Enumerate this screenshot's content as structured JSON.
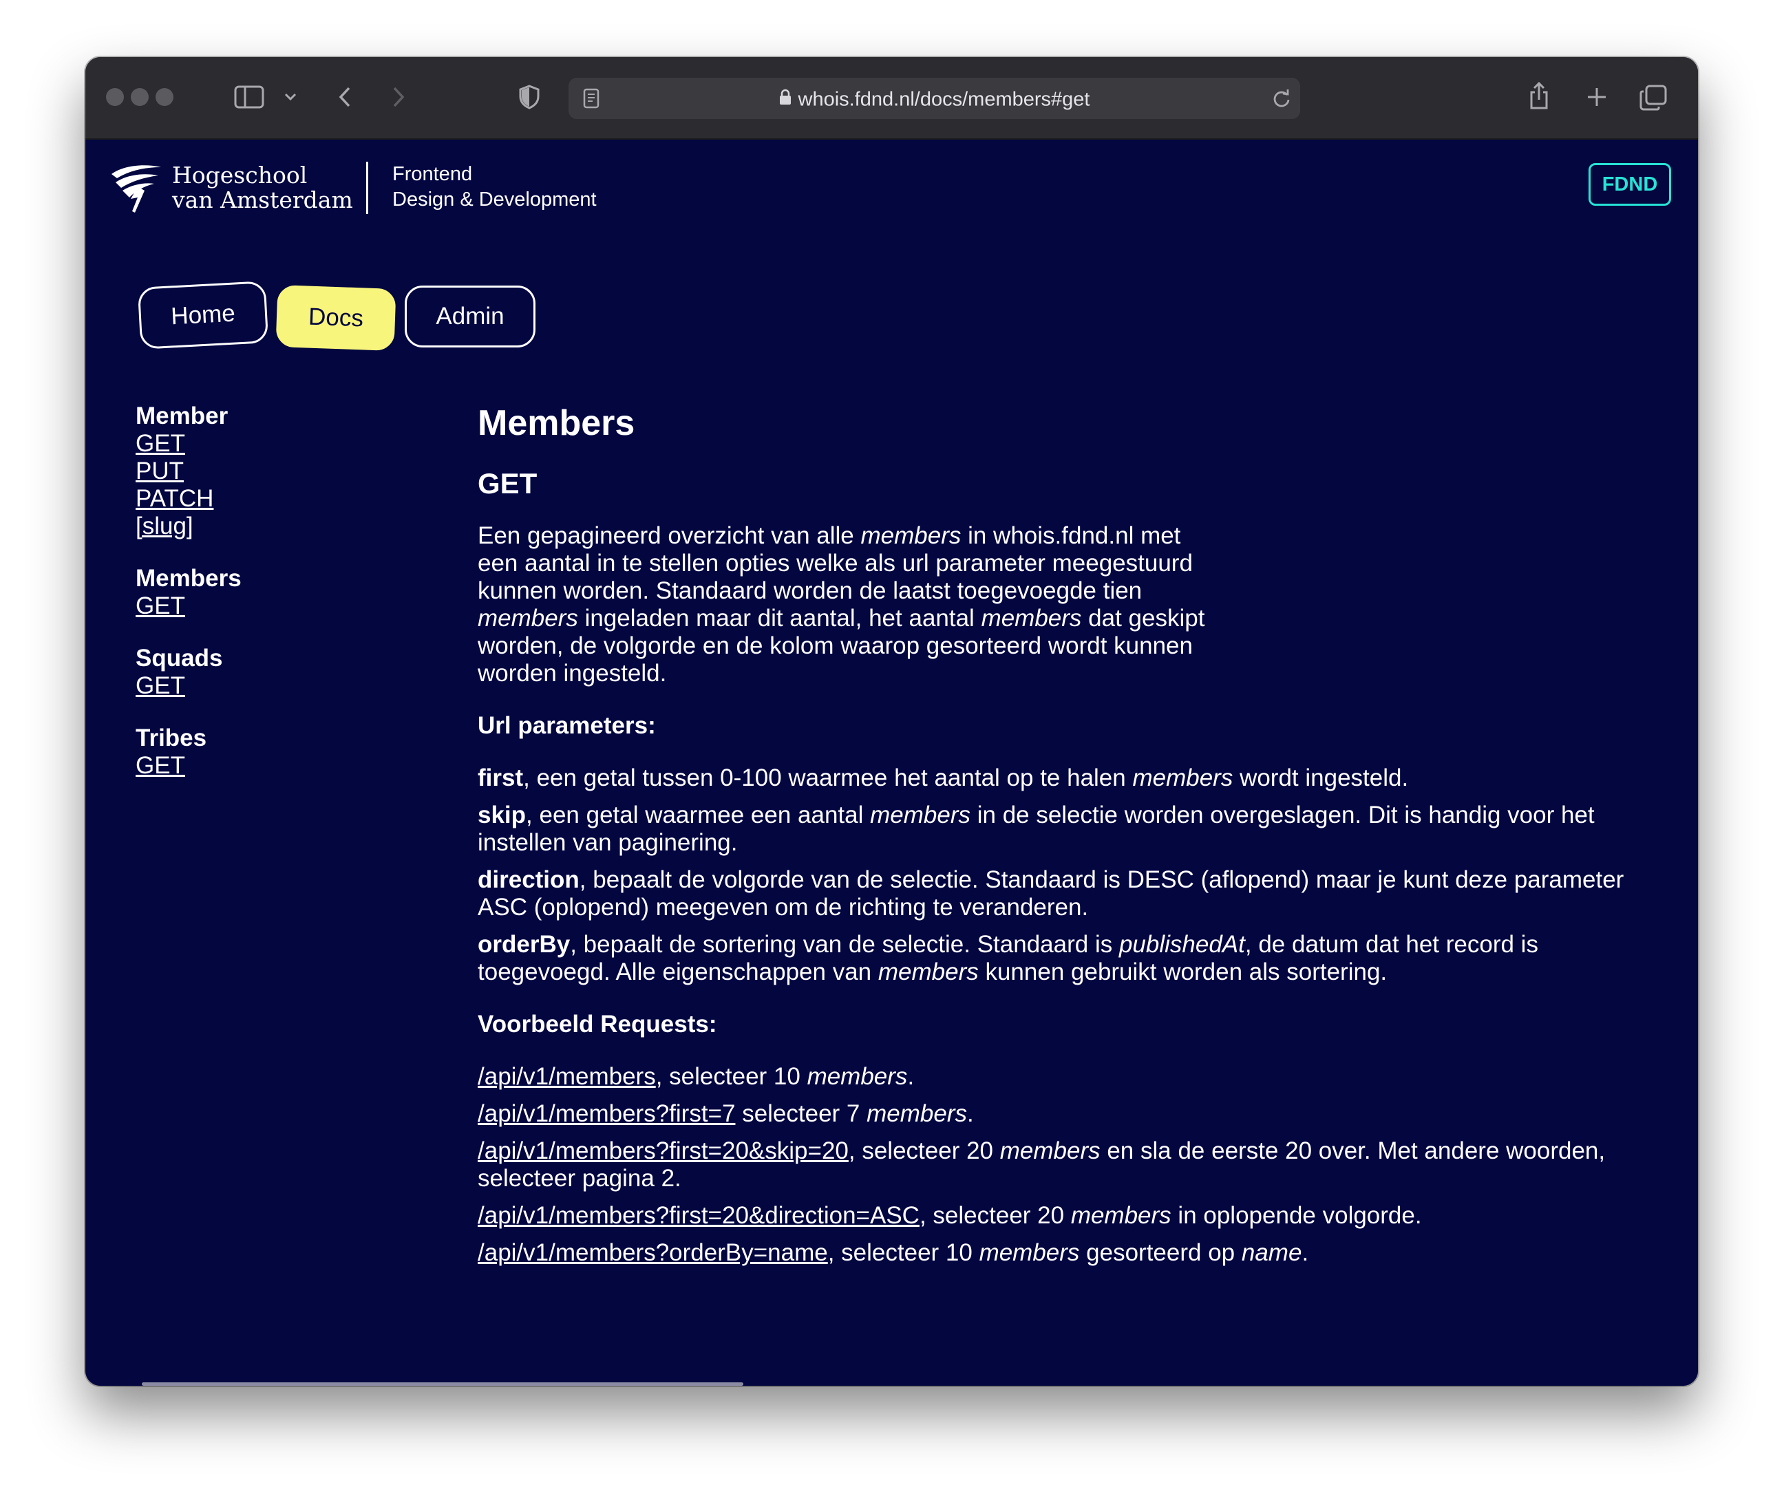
{
  "browser": {
    "url": "whois.fdnd.nl/docs/members#get"
  },
  "header": {
    "logo_line1": "Hogeschool",
    "logo_line2": "van Amsterdam",
    "course_line1": "Frontend",
    "course_line2": "Design & Development",
    "badge": "FDND"
  },
  "nav": {
    "home": "Home",
    "docs": "Docs",
    "admin": "Admin"
  },
  "sidebar": {
    "groups": [
      {
        "title": "Member",
        "links": [
          "GET",
          "PUT",
          "PATCH",
          "[slug]"
        ]
      },
      {
        "title": "Members",
        "links": [
          "GET"
        ]
      },
      {
        "title": "Squads",
        "links": [
          "GET"
        ]
      },
      {
        "title": "Tribes",
        "links": [
          "GET"
        ]
      }
    ]
  },
  "content": {
    "title": "Members",
    "method": "GET",
    "intro": {
      "p1": "Een gepagineerd overzicht van alle ",
      "em1": "members",
      "p2": " in whois.fdnd.nl met een aantal in te stellen opties welke als url parameter meegestuurd kunnen worden. Standaard worden de laatst toegevoegde tien ",
      "em2": "members",
      "p3": " ingeladen maar dit aantal, het aantal ",
      "em3": "members",
      "p4": " dat geskipt worden, de volgorde en de kolom waarop gesorteerd wordt kunnen worden ingesteld."
    },
    "params_heading": "Url parameters:",
    "params": {
      "first": {
        "name": "first",
        "t1": ", een getal tussen 0-100 waarmee het aantal op te halen ",
        "em": "members",
        "t2": " wordt ingesteld."
      },
      "skip": {
        "name": "skip",
        "t1": ", een getal waarmee een aantal ",
        "em": "members",
        "t2": " in de selectie worden overgeslagen. Dit is handig voor het instellen van paginering."
      },
      "direction": {
        "name": "direction",
        "t1": ", bepaalt de volgorde van de selectie. Standaard is DESC (aflopend) maar je kunt deze parameter ASC (oplopend) meegeven om de richting te veranderen."
      },
      "orderBy": {
        "name": "orderBy",
        "t1": ", bepaalt de sortering van de selectie. Standaard is ",
        "em": "publishedAt",
        "t2": ", de datum dat het record is toegevoegd. Alle eigenschappen van ",
        "em2": "members",
        "t3": " kunnen gebruikt worden als sortering."
      }
    },
    "examples_heading": "Voorbeeld Requests:",
    "examples": {
      "e1": {
        "link": "/api/v1/members",
        "t1": ", selecteer 10 ",
        "em": "members",
        "t2": "."
      },
      "e2": {
        "link": "/api/v1/members?first=7",
        "t1": " selecteer 7 ",
        "em": "members",
        "t2": "."
      },
      "e3": {
        "link": "/api/v1/members?first=20&skip=20",
        "t1": ", selecteer 20 ",
        "em": "members",
        "t2": " en sla de eerste 20 over. Met andere woorden, selecteer pagina 2."
      },
      "e4": {
        "link": "/api/v1/members?first=20&direction=ASC",
        "t1": ", selecteer 20 ",
        "em": "members",
        "t2": " in oplopende volgorde."
      },
      "e5": {
        "link": "/api/v1/members?orderBy=name",
        "t1": ", selecteer 10 ",
        "em": "members",
        "t2": " gesorteerd op ",
        "em2": "name",
        "t3": "."
      }
    }
  },
  "colors": {
    "page_bg": "#03063f",
    "accent_yellow": "#f8f57c",
    "accent_teal": "#27e3d6",
    "toolbar_bg": "#2c2b2f"
  }
}
